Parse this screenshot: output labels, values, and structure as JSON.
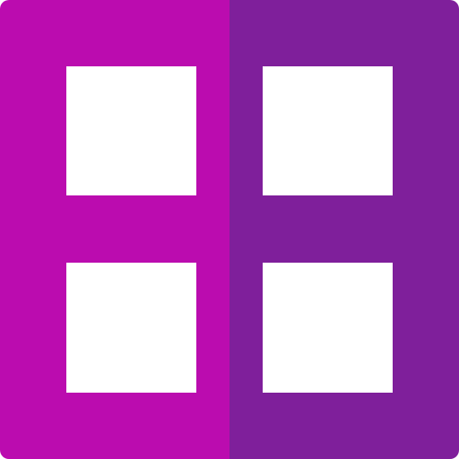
{
  "icon": {
    "name": "grid-view-icon",
    "colors": {
      "left_half": "#BB0CAF",
      "right_half": "#7F1F9B",
      "tiles": "#FFFFFF"
    },
    "tiles": [
      "top-left",
      "top-right",
      "bottom-left",
      "bottom-right"
    ]
  }
}
